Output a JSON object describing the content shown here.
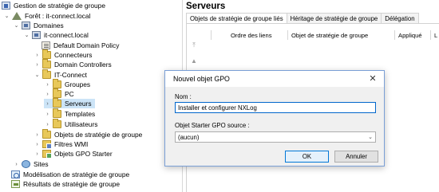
{
  "tree": {
    "items": [
      {
        "label": "Gestion de stratégie de groupe"
      },
      {
        "label": "Forêt : it-connect.local"
      },
      {
        "label": "Domaines"
      },
      {
        "label": "it-connect.local"
      },
      {
        "label": "Default Domain Policy"
      },
      {
        "label": "Connecteurs"
      },
      {
        "label": "Domain Controllers"
      },
      {
        "label": "IT-Connect"
      },
      {
        "label": "Groupes"
      },
      {
        "label": "PC"
      },
      {
        "label": "Serveurs"
      },
      {
        "label": "Templates"
      },
      {
        "label": "Utilisateurs"
      },
      {
        "label": "Objets de stratégie de groupe"
      },
      {
        "label": "Filtres WMI"
      },
      {
        "label": "Objets GPO Starter"
      },
      {
        "label": "Sites"
      },
      {
        "label": "Modélisation de stratégie de groupe"
      },
      {
        "label": "Résultats de stratégie de groupe"
      }
    ]
  },
  "right_pane": {
    "title": "Serveurs",
    "tabs": [
      {
        "label": "Objets de stratégie de groupe liés"
      },
      {
        "label": "Héritage de stratégie de groupe"
      },
      {
        "label": "Délégation"
      }
    ],
    "columns": [
      {
        "label": "Ordre des liens"
      },
      {
        "label": "Objet de stratégie de groupe"
      },
      {
        "label": "Appliqué"
      },
      {
        "label": "L"
      }
    ]
  },
  "dialog": {
    "title": "Nouvel objet GPO",
    "close_glyph": "✕",
    "name_label": "Nom :",
    "name_value": "Installer et configurer NXLog",
    "starter_label": "Objet Starter GPO source :",
    "starter_value": "(aucun)",
    "ok_label": "OK",
    "cancel_label": "Annuler"
  }
}
